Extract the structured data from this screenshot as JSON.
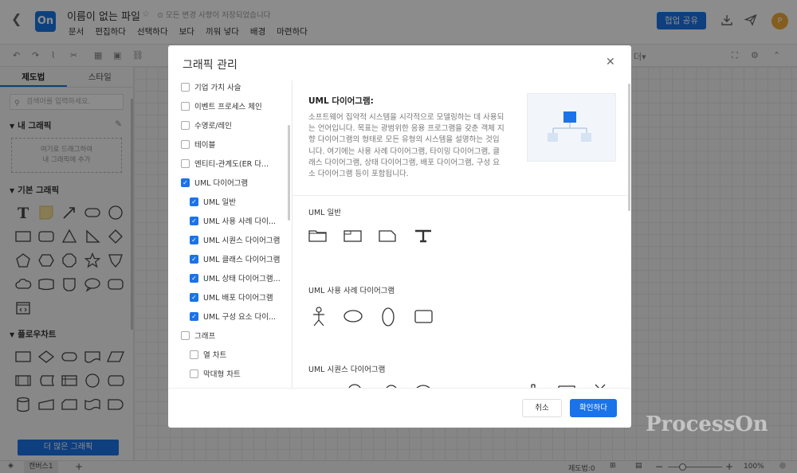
{
  "header": {
    "back_glyph": "❮",
    "logo": "On",
    "title": "이름이 없는 파일",
    "save_status": "모든 변경 사항이 저장되었습니다",
    "menu": [
      "문서",
      "편집하다",
      "선택하다",
      "보다",
      "끼워 넣다",
      "배경",
      "마련하다"
    ],
    "share_label": "협업 공유",
    "avatar": "P"
  },
  "toolbar": {
    "font_dropdown": "더▾"
  },
  "sidebar": {
    "tabs": [
      "제도법",
      "스타일"
    ],
    "search_placeholder": "검색어를 입력하세요.",
    "my_shapes": "내 그래픽",
    "drop_hint": [
      "여기로 드래그하여",
      "내 그래픽에 추가"
    ],
    "basic_shapes": "기본 그래픽",
    "flowchart": "플로우차트",
    "more_button": "더 많은 그래픽"
  },
  "statusbar": {
    "page_tab": "캔버스1",
    "shape_count": "제도법:0",
    "zoom": "100%"
  },
  "watermark": "ProcessOn",
  "dialog": {
    "title": "그래픽 관리",
    "left_items": [
      {
        "label": "기업 가치 사슬",
        "checked": false,
        "indent": 0
      },
      {
        "label": "이벤트 프로세스 체인",
        "checked": false,
        "indent": 0
      },
      {
        "label": "수영로/레인",
        "checked": false,
        "indent": 0
      },
      {
        "label": "테이블",
        "checked": false,
        "indent": 0
      },
      {
        "label": "엔티티-관계도(ER 다...",
        "checked": false,
        "indent": 0
      },
      {
        "label": "UML 다이어그램",
        "checked": true,
        "indent": 0
      },
      {
        "label": "UML 일반",
        "checked": true,
        "indent": 1
      },
      {
        "label": "UML 사용 사례 다이...",
        "checked": true,
        "indent": 1
      },
      {
        "label": "UML 시퀀스 다이어그램",
        "checked": true,
        "indent": 1
      },
      {
        "label": "UML 클래스 다이어그램",
        "checked": true,
        "indent": 1
      },
      {
        "label": "UML 상태 다이어그램...",
        "checked": true,
        "indent": 1
      },
      {
        "label": "UML 배포 다이어그램",
        "checked": true,
        "indent": 1
      },
      {
        "label": "UML 구성 요소 다이...",
        "checked": true,
        "indent": 1
      },
      {
        "label": "그래프",
        "checked": false,
        "indent": 0
      },
      {
        "label": "열 차트",
        "checked": false,
        "indent": 1
      },
      {
        "label": "막대형 차트",
        "checked": false,
        "indent": 1
      }
    ],
    "right_title": "UML 다이어그램:",
    "right_description": "소프트웨어 집약적 시스템을 시각적으로 모델링하는 데 사용되는 언어입니다. 목표는 광범위한 응용 프로그램을 갖춘 객체 지향 다이어그램의 형태로 모든 유형의 시스템을 설명하는 것입니다. 여기에는 사용 사례 다이어그램, 타이밍 다이어그램, 클래스 다이어그램, 상태 다이어그램, 배포 다이어그램, 구성 요소 다이어그램 등이 포함됩니다.",
    "sections": [
      "UML 일반",
      "UML 사용 사례 다이어그램",
      "UML 시퀀스 다이어그램"
    ],
    "cancel_label": "취소",
    "ok_label": "확인하다"
  }
}
